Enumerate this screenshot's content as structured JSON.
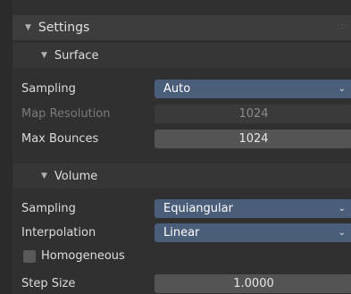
{
  "settings": {
    "title": "Settings"
  },
  "surface": {
    "title": "Surface",
    "sampling": {
      "label": "Sampling",
      "value": "Auto"
    },
    "map_resolution": {
      "label": "Map Resolution",
      "value": "1024"
    },
    "max_bounces": {
      "label": "Max Bounces",
      "value": "1024"
    }
  },
  "volume": {
    "title": "Volume",
    "sampling": {
      "label": "Sampling",
      "value": "Equiangular"
    },
    "interpolation": {
      "label": "Interpolation",
      "value": "Linear"
    },
    "homogeneous": {
      "label": "Homogeneous",
      "checked": false
    },
    "step_size": {
      "label": "Step Size",
      "value": "1.0000"
    }
  },
  "icons": {
    "collapse": "triangle-down-icon",
    "dropdown": "chevron-down-icon",
    "drag": "grip-icon"
  },
  "colors": {
    "dropdown_bg": "#4b5e79",
    "number_bg": "#545454",
    "panel_bg": "#303030"
  }
}
